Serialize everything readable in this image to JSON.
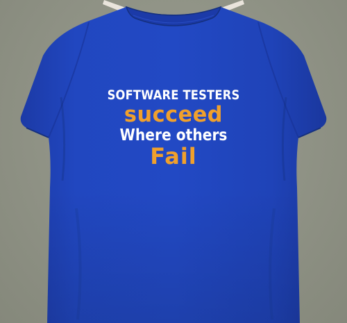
{
  "print": {
    "line1": "SOFTWARE TESTERS",
    "line2": "succeed",
    "line3": "Where others",
    "line4": "Fail"
  },
  "colors": {
    "background": "#8f9285",
    "shirt": "#1f42b8",
    "text_white": "#ffffff",
    "text_orange": "#f0a02c",
    "hanger": "#e9e4dc"
  }
}
